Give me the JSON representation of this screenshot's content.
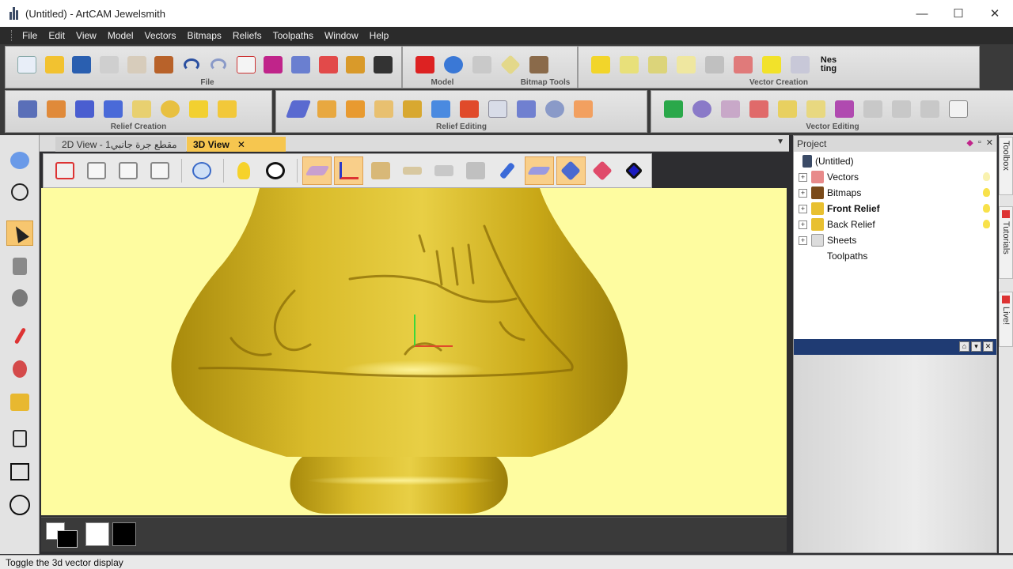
{
  "window": {
    "title": "(Untitled) - ArtCAM Jewelsmith",
    "minimize": "—",
    "maximize": "☐",
    "close": "✕"
  },
  "menu": [
    "File",
    "Edit",
    "View",
    "Model",
    "Vectors",
    "Bitmaps",
    "Reliefs",
    "Toolpaths",
    "Window",
    "Help"
  ],
  "toolbars": {
    "file_caption": "File",
    "model_caption": "Model",
    "bitmap_caption": "Bitmap Tools",
    "vector_creation_caption": "Vector Creation",
    "relief_creation_caption": "Relief Creation",
    "relief_editing_caption": "Relief Editing",
    "vector_editing_caption": "Vector Editing",
    "nesting_label": "Nes\nting"
  },
  "tabs": {
    "view2d_label": "2D View - مقطع جرة جانبي1",
    "view3d_label": "3D View",
    "close_glyph": "✕",
    "dropdown_glyph": "▼"
  },
  "project": {
    "header": "Project",
    "items": [
      {
        "label": "(Untitled)"
      },
      {
        "label": "Vectors"
      },
      {
        "label": "Bitmaps"
      },
      {
        "label": "Front Relief"
      },
      {
        "label": "Back Relief"
      },
      {
        "label": "Sheets"
      },
      {
        "label": "Toolpaths"
      }
    ]
  },
  "side_tabs": [
    "Toolbox",
    "Tutorials",
    "Live!"
  ],
  "status": {
    "text": "Toggle the 3d vector display"
  },
  "colors": {
    "accent_tab": "#f6c64f",
    "viewport_bg": "#fefca0",
    "relief_gold": "#c9a817",
    "panel_divider": "#1f3b73"
  }
}
